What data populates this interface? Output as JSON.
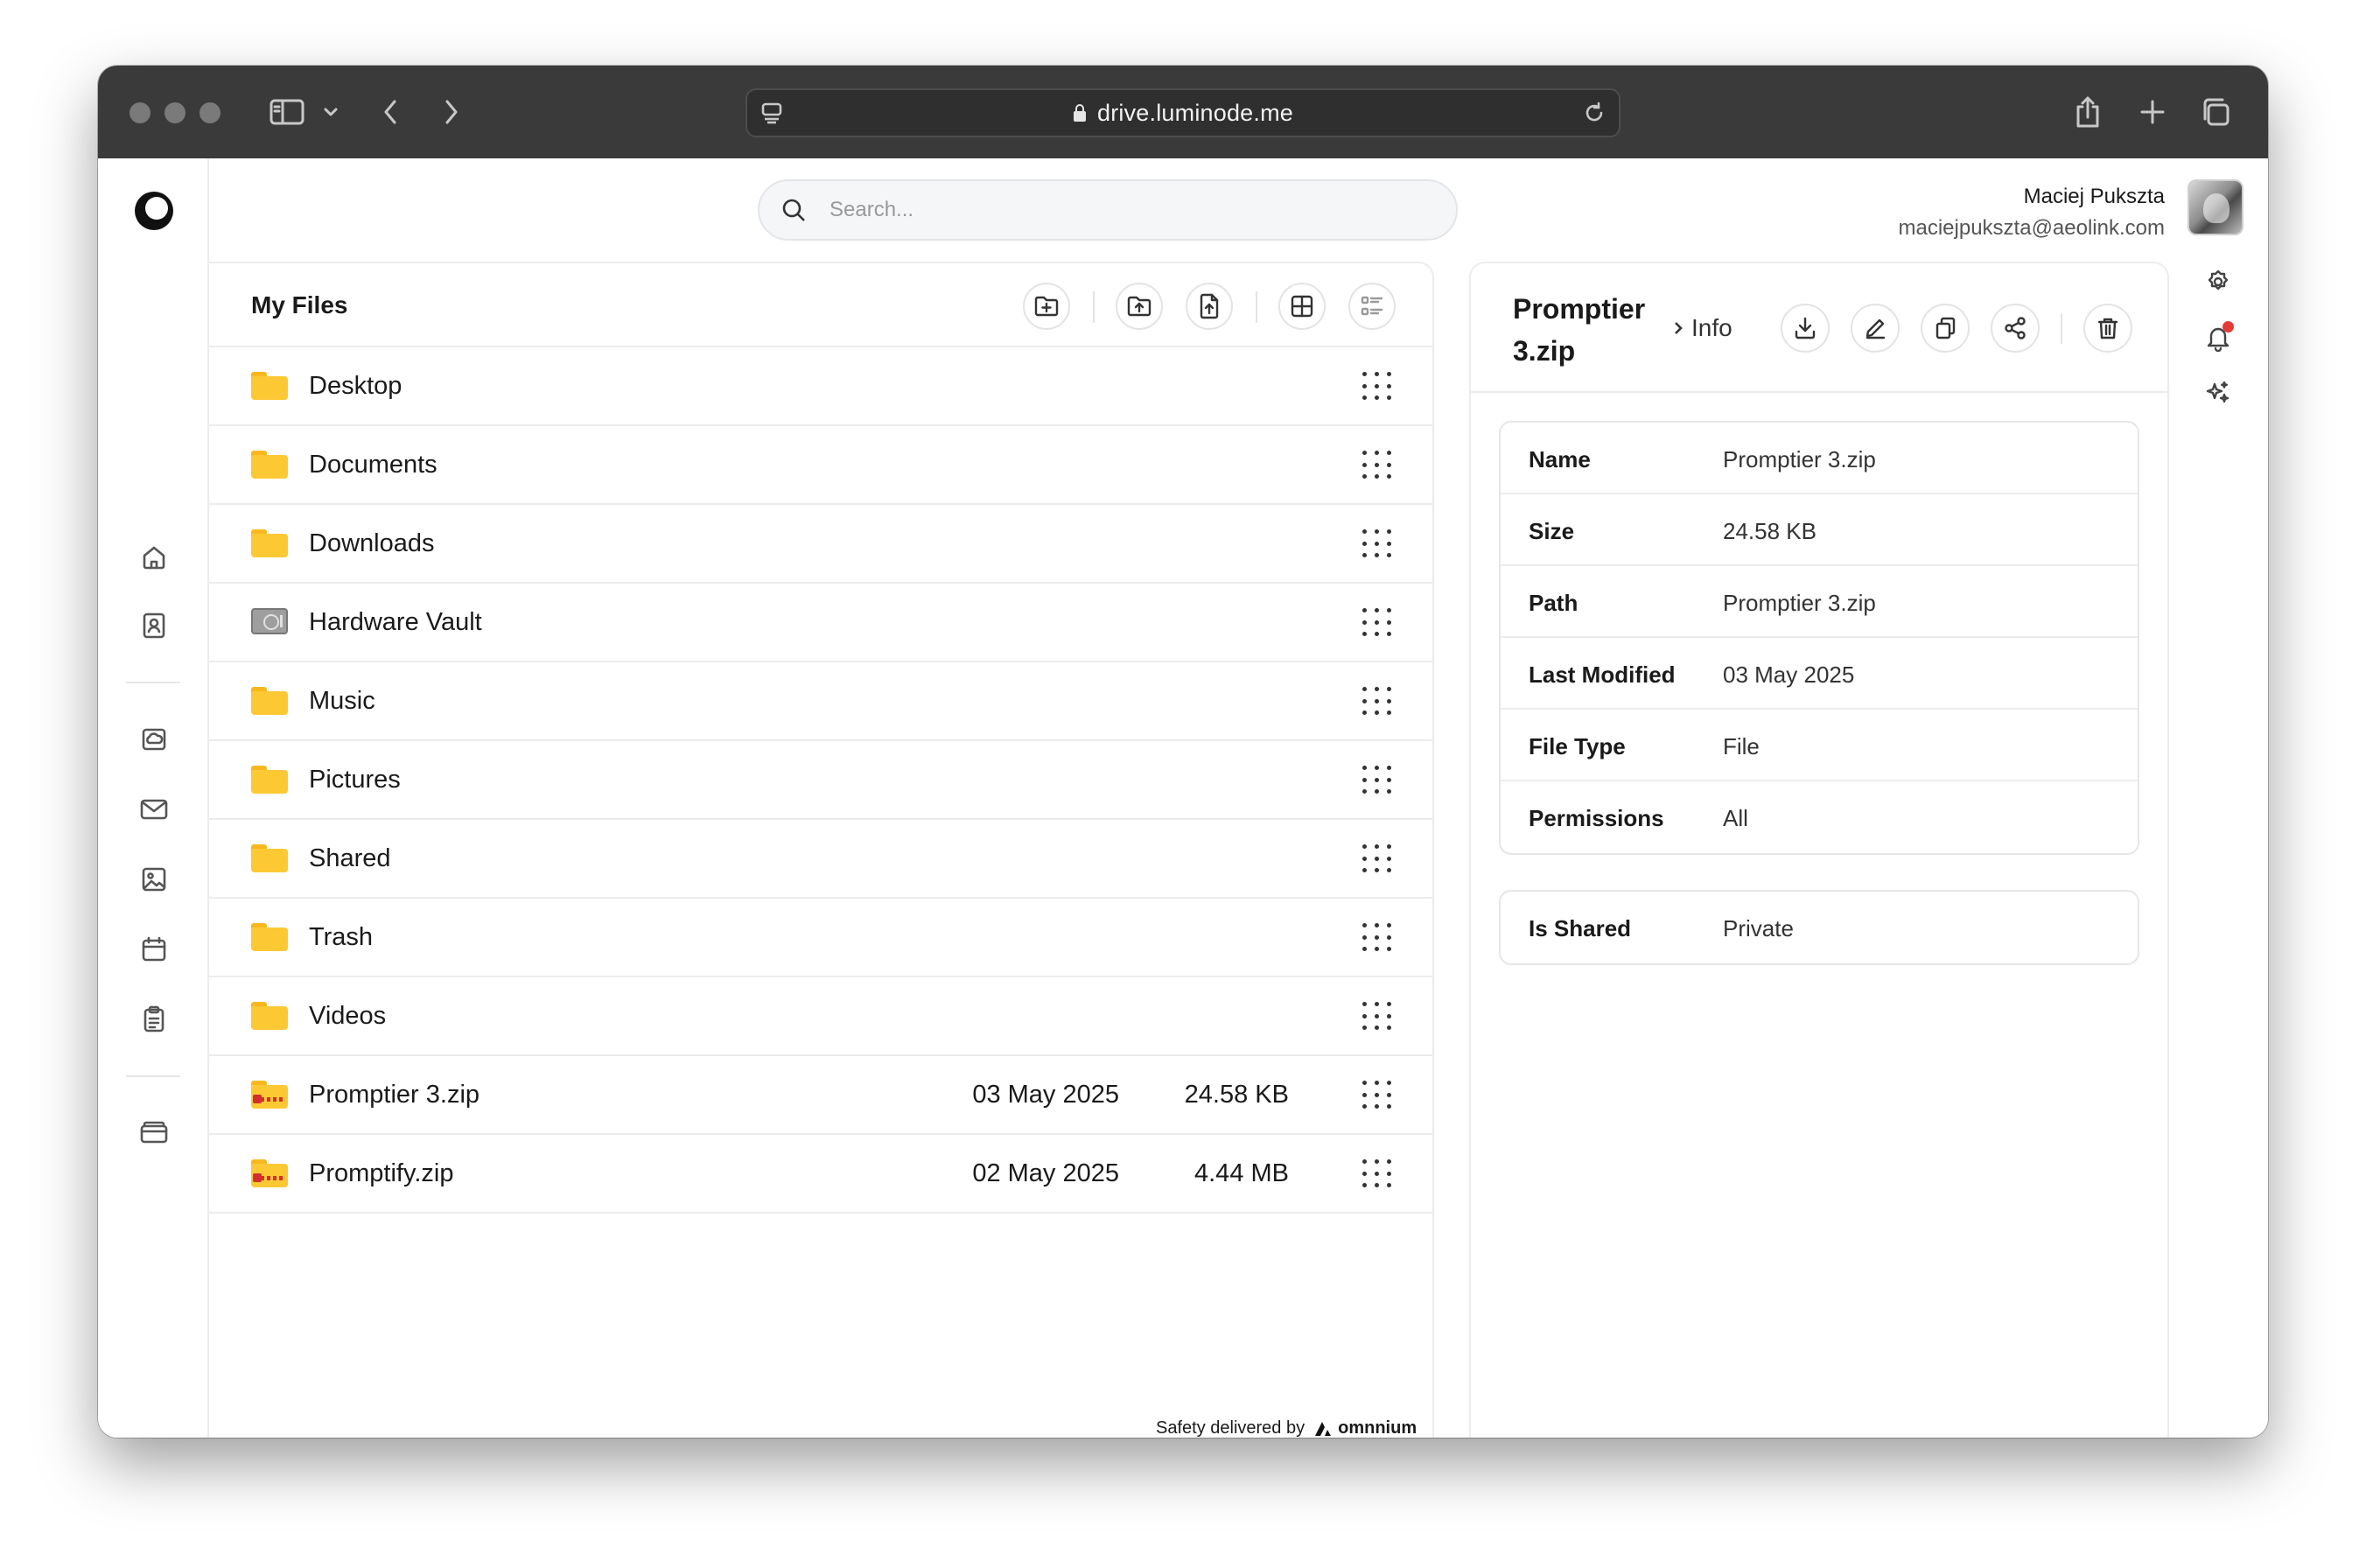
{
  "browser": {
    "url": "drive.luminode.me"
  },
  "search": {
    "placeholder": "Search..."
  },
  "user": {
    "name": "Maciej Pukszta",
    "email": "maciejpukszta@aeolink.com"
  },
  "files": {
    "title": "My Files",
    "toolbar_icons": [
      "new-folder-icon",
      "upload-folder-icon",
      "upload-file-icon",
      "grid-view-icon",
      "list-view-icon"
    ],
    "rows": [
      {
        "name": "Desktop",
        "type": "folder",
        "date": "",
        "size": ""
      },
      {
        "name": "Documents",
        "type": "folder",
        "date": "",
        "size": ""
      },
      {
        "name": "Downloads",
        "type": "folder",
        "date": "",
        "size": ""
      },
      {
        "name": "Hardware Vault",
        "type": "vault",
        "date": "",
        "size": ""
      },
      {
        "name": "Music",
        "type": "folder",
        "date": "",
        "size": ""
      },
      {
        "name": "Pictures",
        "type": "folder",
        "date": "",
        "size": ""
      },
      {
        "name": "Shared",
        "type": "folder",
        "date": "",
        "size": ""
      },
      {
        "name": "Trash",
        "type": "folder",
        "date": "",
        "size": ""
      },
      {
        "name": "Videos",
        "type": "folder",
        "date": "",
        "size": ""
      },
      {
        "name": "Promptier 3.zip",
        "type": "zip",
        "date": "03 May 2025",
        "size": "24.58 KB"
      },
      {
        "name": "Promptify.zip",
        "type": "zip",
        "date": "02 May 2025",
        "size": "4.44 MB"
      }
    ]
  },
  "footer": {
    "label": "Safety delivered by",
    "brand": "omnnium"
  },
  "info": {
    "title": "Promptier 3.zip",
    "crumb": "Info",
    "actions": [
      "download-icon",
      "edit-icon",
      "copy-icon",
      "share-icon",
      "trash-icon"
    ],
    "properties": [
      {
        "key": "Name",
        "value": "Promptier 3.zip"
      },
      {
        "key": "Size",
        "value": "24.58 KB"
      },
      {
        "key": "Path",
        "value": "Promptier 3.zip"
      },
      {
        "key": "Last Modified",
        "value": "03 May 2025"
      },
      {
        "key": "File Type",
        "value": "File"
      },
      {
        "key": "Permissions",
        "value": "All"
      }
    ],
    "sharing": [
      {
        "key": "Is Shared",
        "value": "Private"
      }
    ]
  },
  "colors": {
    "folder": "#fcc934",
    "notification_dot": "#e53935",
    "chrome": "#3a3a3a"
  }
}
